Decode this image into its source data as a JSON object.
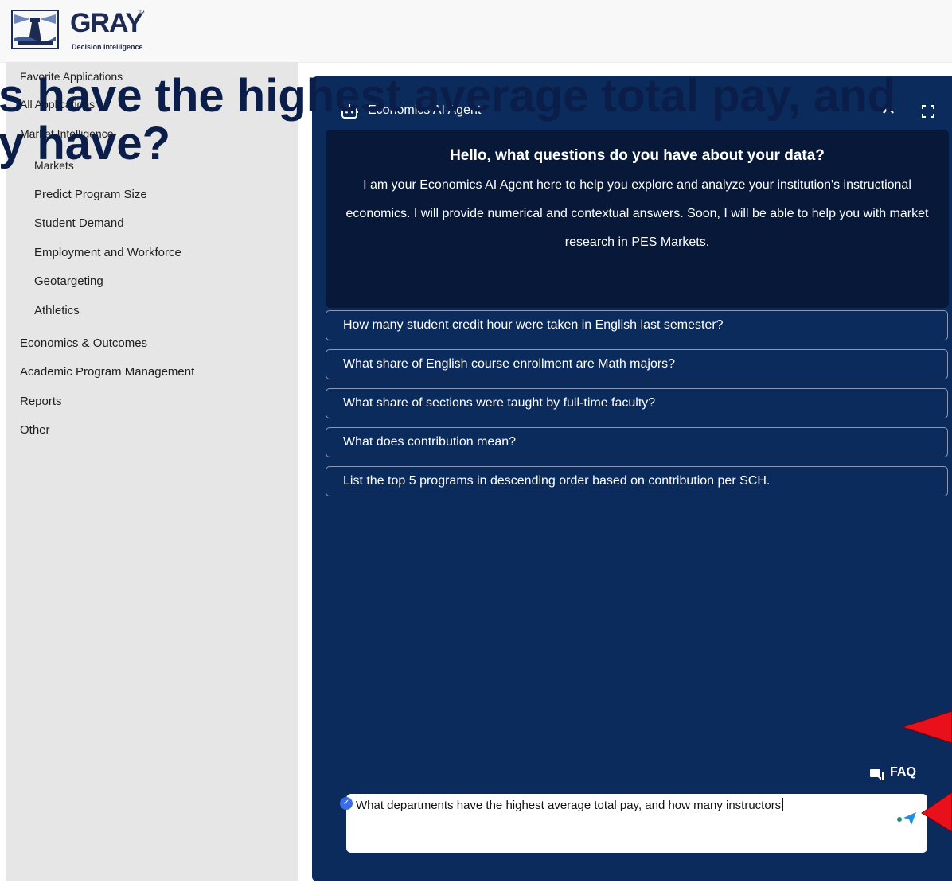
{
  "brand": {
    "name": "GRAY",
    "trademark": "™",
    "tagline": "Decision Intelligence"
  },
  "sidebar": {
    "items": [
      {
        "label": "Favorite Applications"
      },
      {
        "label": "All Applications"
      },
      {
        "label": "Market Intelligence"
      },
      {
        "label": "Markets"
      },
      {
        "label": "Predict Program Size"
      },
      {
        "label": "Student Demand"
      },
      {
        "label": "Employment and Workforce"
      },
      {
        "label": "Geotargeting"
      },
      {
        "label": "Athletics"
      },
      {
        "label": "Economics & Outcomes"
      },
      {
        "label": "Academic Program Management"
      },
      {
        "label": "Reports"
      },
      {
        "label": "Other"
      }
    ]
  },
  "overlay": {
    "line1": "s have the highest average total pay, and",
    "line2": "y have?"
  },
  "agent": {
    "title": "Economics AI Agent",
    "hero_title": "Hello, what questions do you have about your data?",
    "hero_text": "I am your Economics AI Agent here to help you explore and analyze your institution's instructional economics. I will provide numerical and contextual answers. Soon, I will be able to help you with market research in PES Markets.",
    "suggestions": [
      "How many student credit hour were taken in English last semester?",
      "What share of English course enrollment are Math majors?",
      "What share of sections were taught by full-time faculty?",
      "What does contribution mean?",
      "List the top 5 programs in descending order based on contribution per SCH."
    ],
    "faq_label": "FAQ",
    "input_value": "What departments have the highest average total pay, and how many instructors"
  },
  "colors": {
    "panel": "#0b2b5c",
    "hero": "#071838",
    "accent_arrow": "#e8101a"
  }
}
